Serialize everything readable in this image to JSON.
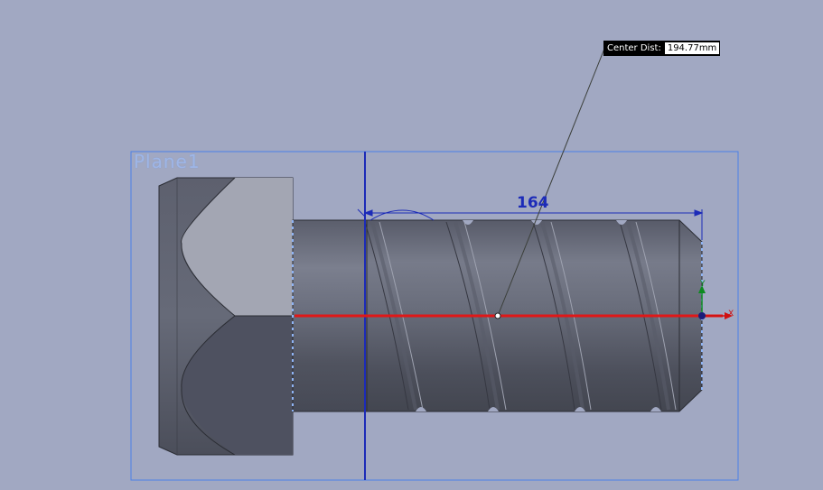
{
  "plane": {
    "name": "Plane1"
  },
  "dimension": {
    "value": "164"
  },
  "measure_tooltip": {
    "label": "Center Dist:",
    "value": "194.77mm"
  },
  "triad": {
    "x_label": "X",
    "y_label": "Y"
  },
  "colors": {
    "background": "#a1a8c2",
    "plane_border": "#4a7fe8",
    "sketch_line": "#1c2bb8",
    "axis_line": "#e01818",
    "model_dark": "#4e5160",
    "model_mid": "#6a6e7e",
    "model_light": "#9a9eac"
  }
}
